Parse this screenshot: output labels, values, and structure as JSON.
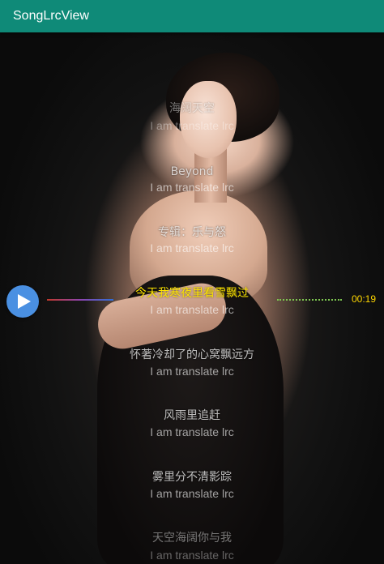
{
  "app": {
    "title": "SongLrcView"
  },
  "lyrics": {
    "lines": [
      {
        "text": "海阔天空",
        "translation": "I am translate lrc"
      },
      {
        "text": "Beyond",
        "translation": "I am translate lrc"
      },
      {
        "text": "专辑：乐与怒",
        "translation": "I am translate lrc"
      },
      {
        "text": "今天我寒夜里看雪飘过",
        "translation": "I am translate lrc"
      },
      {
        "text": "怀著冷却了的心窝飘远方",
        "translation": "I am translate lrc"
      },
      {
        "text": "风雨里追赶",
        "translation": "I am translate lrc"
      },
      {
        "text": "雾里分不清影踪",
        "translation": "I am translate lrc"
      },
      {
        "text": "天空海阔你与我",
        "translation": "I am translate lrc"
      }
    ],
    "current_index": 3
  },
  "player": {
    "current_time": "00:19",
    "play_icon": "play-icon"
  },
  "colors": {
    "appbar": "#0f8a78",
    "play_button": "#4a90e2",
    "highlight": "#ffe600",
    "time": "#ffd700",
    "indicator_right": "#7ec850"
  }
}
